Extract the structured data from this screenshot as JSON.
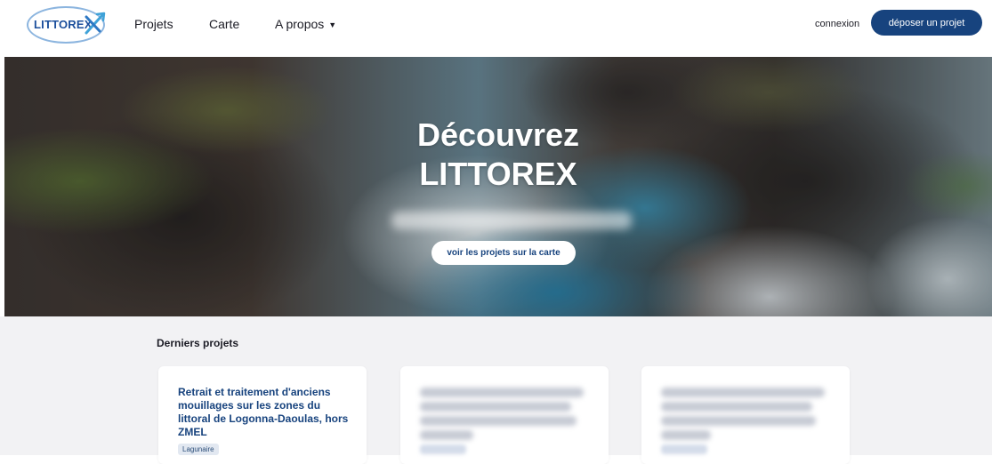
{
  "header": {
    "logo_text": "LITTOREX",
    "nav": [
      {
        "label": "Projets"
      },
      {
        "label": "Carte"
      },
      {
        "label": "A propos",
        "caret": "▼"
      }
    ],
    "login_label": "connexion",
    "submit_label": "déposer un projet"
  },
  "hero": {
    "title_line1": "Découvrez",
    "title_line2": "LITTOREX",
    "cta_label": "voir les projets sur la carte"
  },
  "projects": {
    "section_title": "Derniers projets",
    "cards": [
      {
        "title": "Retrait et traitement d'anciens mouillages sur les zones du littoral de Logonna-Daoulas, hors ZMEL",
        "tag": "Lagunaire"
      }
    ]
  },
  "colors": {
    "brand_dark_blue": "#17437e",
    "logo_blue": "#2e78c4",
    "section_background": "#f2f2f4"
  }
}
